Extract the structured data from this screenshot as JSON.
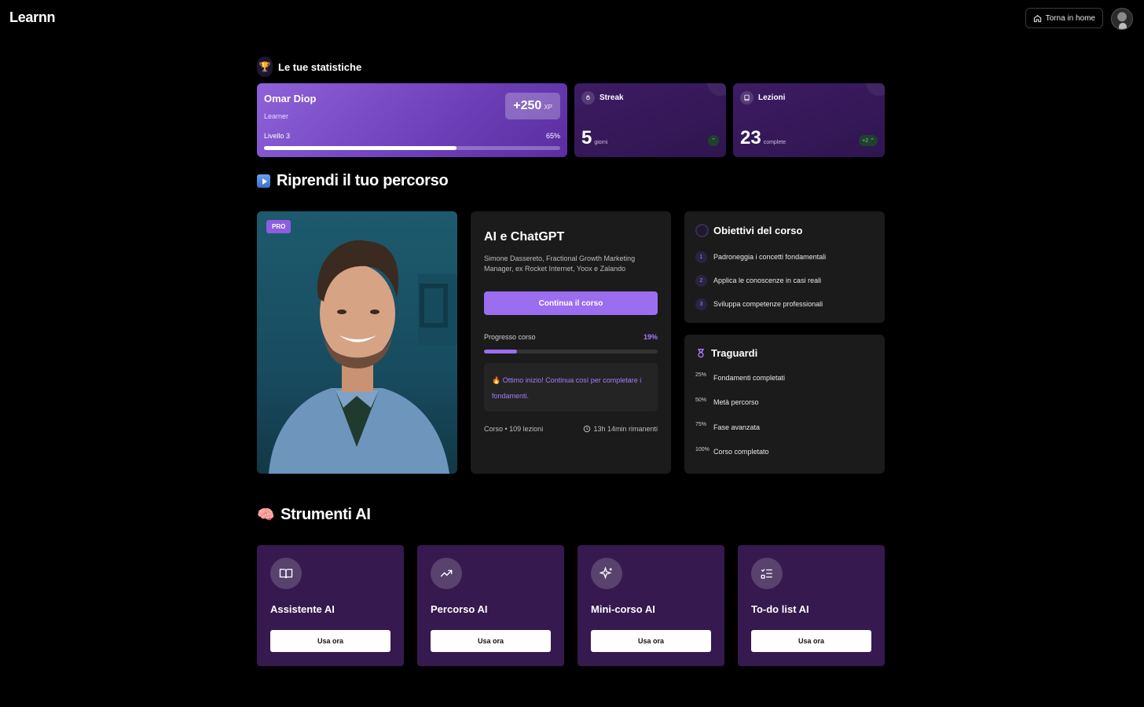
{
  "header": {
    "logo": "Learnn",
    "home_button": "Torna in home",
    "avatar_icon": "user-avatar"
  },
  "stats": {
    "title": "Le tue statistiche",
    "title_icon": "trophy-icon",
    "user": {
      "name": "Omar Diop",
      "role": "Learner",
      "xp_value": "+250",
      "xp_unit": "XP",
      "level_label": "Livello 3",
      "level_percent_label": "65%",
      "level_progress": 0.65
    },
    "streak": {
      "label": "Streak",
      "icon": "flame-icon",
      "value": "5",
      "unit": "giorni"
    },
    "lessons": {
      "label": "Lezioni",
      "icon": "book-icon",
      "value": "23",
      "unit": "complete",
      "delta": "+2"
    }
  },
  "resume": {
    "title": "Riprendi il tuo percorso",
    "title_icon": "play-icon",
    "badge": "PRO",
    "course": {
      "title": "AI e ChatGPT",
      "author": "Simone Dassereto, Fractional Growth Marketing Manager, ex Rocket Internet, Yoox e Zalando",
      "cta": "Continua il corso",
      "progress_label": "Progresso corso",
      "progress_text": "19%",
      "progress": 0.19,
      "note": "🔥 Ottimo inizio! Continua così per completare i fondamenti.",
      "meta": "Corso • 109 lezioni",
      "time_left": "13h 14min rimanenti"
    },
    "objectives": {
      "title": "Obiettivi del corso",
      "items": [
        {
          "num": "1",
          "text": "Padroneggia i concetti fondamentali"
        },
        {
          "num": "2",
          "text": "Applica le conoscenze in casi reali"
        },
        {
          "num": "3",
          "text": "Sviluppa competenze professionali"
        }
      ]
    },
    "milestones": {
      "title": "Traguardi",
      "icon": "medal-icon",
      "items": [
        {
          "pct": "25%",
          "text": "Fondamenti completati"
        },
        {
          "pct": "50%",
          "text": "Metà percorso"
        },
        {
          "pct": "75%",
          "text": "Fase avanzata"
        },
        {
          "pct": "100%",
          "text": "Corso completato"
        }
      ]
    }
  },
  "tools": {
    "title": "Strumenti AI",
    "title_icon": "brain-icon",
    "items": [
      {
        "name": "Assistente AI",
        "icon": "book-open-icon",
        "cta": "Usa ora"
      },
      {
        "name": "Percorso AI",
        "icon": "trending-up-icon",
        "cta": "Usa ora"
      },
      {
        "name": "Mini-corso AI",
        "icon": "sparkles-icon",
        "cta": "Usa ora"
      },
      {
        "name": "To-do list AI",
        "icon": "checklist-icon",
        "cta": "Usa ora"
      }
    ]
  },
  "colors": {
    "accent": "#9b6ef0",
    "card_purple": "#35194f",
    "card_dark": "#1b1b1b",
    "success": "#5fdc86"
  }
}
